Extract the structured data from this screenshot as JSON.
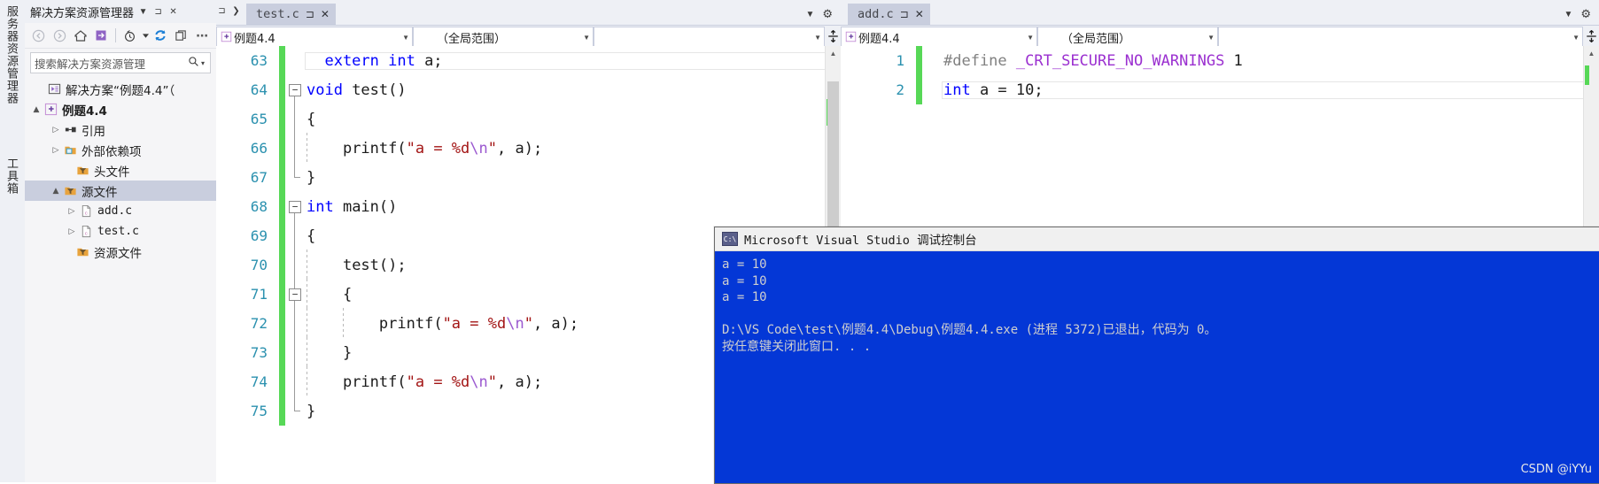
{
  "vertical_dock": {
    "items": [
      {
        "label": "服务器资源管理器"
      },
      {
        "label": "工具箱"
      }
    ]
  },
  "solution_explorer": {
    "title": "解决方案资源管理器",
    "title_dropdown_icon": "chevron-down-icon",
    "pin_icon": "pin-icon",
    "close_icon": "close-icon",
    "toolbar": [
      {
        "name": "back-icon",
        "glyph": "◄"
      },
      {
        "name": "forward-icon",
        "glyph": "►"
      },
      {
        "name": "home-icon",
        "glyph": "⌂"
      },
      {
        "name": "sync-with-active-document-icon",
        "glyph": "⇱"
      },
      {
        "name": "pending-changes-icon",
        "glyph": "◔"
      },
      {
        "name": "pending-changes-dropdown-icon",
        "glyph": "▾"
      },
      {
        "name": "refresh-icon",
        "glyph": "⟳"
      },
      {
        "name": "show-all-files-icon",
        "glyph": "❐"
      },
      {
        "name": "properties-icon",
        "glyph": "⋯"
      }
    ],
    "search": {
      "placeholder": "搜索解决方案资源管理",
      "value": "",
      "icon": "search-icon"
    },
    "tree": [
      {
        "label": "解决方案“例题4.4”（",
        "icon": "solution-icon",
        "arrow": "",
        "indent": 0,
        "bold": false,
        "selected": false
      },
      {
        "label": "例题4.4",
        "icon": "project-icon",
        "arrow": "▲",
        "indent": 0,
        "bold": true,
        "selected": false
      },
      {
        "label": "引用",
        "icon": "references-icon",
        "arrow": "▷",
        "indent": 1,
        "bold": false,
        "selected": false
      },
      {
        "label": "外部依赖项",
        "icon": "external-deps-icon",
        "arrow": "▷",
        "indent": 1,
        "bold": false,
        "selected": false
      },
      {
        "label": "头文件",
        "icon": "filter-folder-icon",
        "arrow": "",
        "indent": 1,
        "bold": false,
        "selected": false
      },
      {
        "label": "源文件",
        "icon": "filter-folder-icon",
        "arrow": "▲",
        "indent": 1,
        "bold": false,
        "selected": true
      },
      {
        "label": "add.c",
        "icon": "c-file-icon",
        "arrow": "▷",
        "indent": 2,
        "bold": false,
        "selected": false
      },
      {
        "label": "test.c",
        "icon": "c-file-icon",
        "arrow": "▷",
        "indent": 2,
        "bold": false,
        "selected": false
      },
      {
        "label": "资源文件",
        "icon": "filter-folder-icon",
        "arrow": "",
        "indent": 1,
        "bold": false,
        "selected": false
      }
    ]
  },
  "left_pane": {
    "tab": {
      "name": "test.c",
      "pin_icon": "pin-icon",
      "close_icon": "close-icon"
    },
    "tabstrip_right": {
      "dropdown_icon": "chevron-down-icon",
      "settings_icon": "gear-icon"
    },
    "navbar": {
      "project": "例题4.4",
      "project_icon": "project-icon",
      "scope": "（全局范围）",
      "member": "",
      "split_icon": "split-window-icon"
    },
    "code_lines": [
      {
        "num": "63",
        "fold": "none",
        "text": "    extern int a;"
      },
      {
        "num": "64",
        "fold": "minus",
        "text": "void test()"
      },
      {
        "num": "65",
        "fold": "line",
        "text": "{"
      },
      {
        "num": "66",
        "fold": "line",
        "text": "    printf(\"a = %d\\n\", a);"
      },
      {
        "num": "67",
        "fold": "elbow",
        "text": "}"
      },
      {
        "num": "68",
        "fold": "minus",
        "text": "int main()"
      },
      {
        "num": "69",
        "fold": "line",
        "text": "{"
      },
      {
        "num": "70",
        "fold": "line",
        "text": "    test();"
      },
      {
        "num": "71",
        "fold": "minus2",
        "text": "    {"
      },
      {
        "num": "72",
        "fold": "line",
        "text": "        printf(\"a = %d\\n\", a);"
      },
      {
        "num": "73",
        "fold": "line",
        "text": "    }"
      },
      {
        "num": "74",
        "fold": "line",
        "text": "    printf(\"a = %d\\n\", a);"
      },
      {
        "num": "75",
        "fold": "elbow",
        "text": "}"
      }
    ],
    "scrollbar": {
      "up_icon": "scroll-up-icon",
      "down_icon": "scroll-down-icon"
    }
  },
  "right_pane": {
    "tab": {
      "name": "add.c",
      "pin_icon": "pin-icon",
      "close_icon": "close-icon"
    },
    "tabstrip_right": {
      "dropdown_icon": "chevron-down-icon",
      "settings_icon": "gear-icon"
    },
    "navbar": {
      "project": "例题4.4",
      "project_icon": "project-icon",
      "scope": "（全局范围）",
      "member": "",
      "split_icon": "split-window-icon"
    },
    "code_lines": [
      {
        "num": "1",
        "text": "#define _CRT_SECURE_NO_WARNINGS 1"
      },
      {
        "num": "2",
        "text": "int a = 10;"
      }
    ]
  },
  "console": {
    "title": "Microsoft Visual Studio 调试控制台",
    "icon": "console-app-icon",
    "output": [
      "a = 10",
      "a = 10",
      "a = 10",
      "",
      "D:\\VS Code\\test\\例题4.4\\Debug\\例题4.4.exe (进程 5372)已退出，代码为 0。",
      "按任意键关闭此窗口. . ."
    ],
    "background_color": "#0437d6",
    "text_color": "#cfcfcf"
  },
  "watermark": "CSDN @iYYu"
}
